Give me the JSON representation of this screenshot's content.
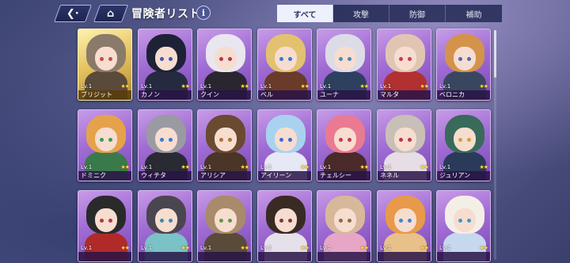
{
  "header": {
    "back_icon": "back-arrow-icon",
    "home_icon": "home-icon",
    "title": "冒険者リスト",
    "info_label": "i"
  },
  "tabs": [
    {
      "label": "すべて",
      "active": true
    },
    {
      "label": "攻撃",
      "active": false
    },
    {
      "label": "防御",
      "active": false
    },
    {
      "label": "補助",
      "active": false
    }
  ],
  "colors": {
    "card_purple": "#9f6cd3",
    "card_gold": "#e6c463",
    "tab_active_bg": "#eef1fb",
    "star": "#ffd84a"
  },
  "cards": [
    {
      "name": "ブリジット",
      "level": "Lv.1",
      "rarity": "gold",
      "stars": "★★",
      "hair": "#8a7a6a",
      "eye": "#c05040",
      "outfit": "#5a4a3a"
    },
    {
      "name": "カノン",
      "level": "Lv.1",
      "rarity": "purple",
      "stars": "★★",
      "hair": "#1e2235",
      "eye": "#3a5ab0",
      "outfit": "#252a40"
    },
    {
      "name": "クイン",
      "level": "Lv.1",
      "rarity": "purple",
      "stars": "★★",
      "hair": "#e9e6ef",
      "eye": "#b23a4a",
      "outfit": "#2a2630"
    },
    {
      "name": "ベル",
      "level": "Lv.1",
      "rarity": "purple",
      "stars": "★★",
      "hair": "#e2c270",
      "eye": "#3a7ad0",
      "outfit": "#6a3a2a"
    },
    {
      "name": "ユーナ",
      "level": "Lv.1",
      "rarity": "purple",
      "stars": "★★",
      "hair": "#dcdce6",
      "eye": "#4a8ab0",
      "outfit": "#2e4060"
    },
    {
      "name": "マルタ",
      "level": "Lv.1",
      "rarity": "purple",
      "stars": "★★",
      "hair": "#e0c6b2",
      "eye": "#c04050",
      "outfit": "#b23030"
    },
    {
      "name": "ベロニカ",
      "level": "Lv.1",
      "rarity": "purple",
      "stars": "★★",
      "hair": "#d4934a",
      "eye": "#4a6ab0",
      "outfit": "#3a4660"
    },
    {
      "name": "ドミニク",
      "level": "Lv.1",
      "rarity": "purple",
      "stars": "★★",
      "hair": "#e6a24a",
      "eye": "#3a9a5a",
      "outfit": "#3a7a4a"
    },
    {
      "name": "ウィチタ",
      "level": "Lv.1",
      "rarity": "purple",
      "stars": "★★",
      "hair": "#9a9aa2",
      "eye": "#3a7ad0",
      "outfit": "#2a2a35"
    },
    {
      "name": "アリシア",
      "level": "Lv.1",
      "rarity": "purple",
      "stars": "★★",
      "hair": "#6a4a30",
      "eye": "#b07030",
      "outfit": "#4a3528"
    },
    {
      "name": "アイリーン",
      "level": "Lv.1",
      "rarity": "purple",
      "stars": "★★",
      "hair": "#a9d2f0",
      "eye": "#3a6ad0",
      "outfit": "#e6e8f5"
    },
    {
      "name": "チェルシー",
      "level": "Lv.1",
      "rarity": "purple",
      "stars": "★★",
      "hair": "#ea7a92",
      "eye": "#c03a50",
      "outfit": "#4a2a2a"
    },
    {
      "name": "ネネル",
      "level": "Lv.1",
      "rarity": "purple",
      "stars": "★★",
      "hair": "#c8c0b6",
      "eye": "#b03a4a",
      "outfit": "#e6dde6"
    },
    {
      "name": "ジュリアン",
      "level": "Lv.1",
      "rarity": "purple",
      "stars": "★★",
      "hair": "#3a6a5a",
      "eye": "#d0a03a",
      "outfit": "#2a3a5a"
    },
    {
      "name": "",
      "level": "Lv.1",
      "rarity": "purple",
      "stars": "★★",
      "hair": "#2a2a2a",
      "eye": "#b03a3a",
      "outfit": "#b02a2a"
    },
    {
      "name": "",
      "level": "Lv.1",
      "rarity": "purple",
      "stars": "★★",
      "hair": "#4a4650",
      "eye": "#3a8ab0",
      "outfit": "#7ac2c6"
    },
    {
      "name": "",
      "level": "Lv.1",
      "rarity": "purple",
      "stars": "★★",
      "hair": "#a98a6a",
      "eye": "#5a9a4a",
      "outfit": "#5a4a3a"
    },
    {
      "name": "",
      "level": "Lv.1",
      "rarity": "purple",
      "stars": "★★",
      "hair": "#3a2a24",
      "eye": "#7a3a3a",
      "outfit": "#e6e0ea"
    },
    {
      "name": "",
      "level": "Lv.1",
      "rarity": "purple",
      "stars": "★★",
      "hair": "#d8b89a",
      "eye": "#8a6a4a",
      "outfit": "#e8a6c6"
    },
    {
      "name": "",
      "level": "Lv.1",
      "rarity": "purple",
      "stars": "★★",
      "hair": "#e89a4a",
      "eye": "#3a8ad0",
      "outfit": "#e8c08a"
    },
    {
      "name": "",
      "level": "Lv.1",
      "rarity": "purple",
      "stars": "★★",
      "hair": "#f4efe6",
      "eye": "#3a9ad0",
      "outfit": "#c6d8ee"
    }
  ]
}
